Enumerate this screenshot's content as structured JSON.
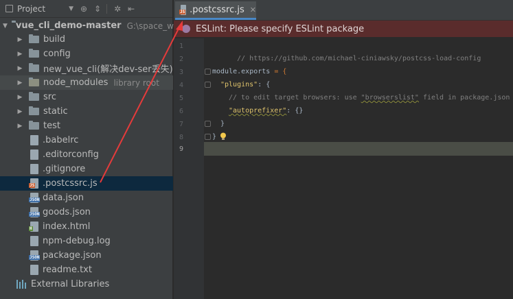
{
  "project_panel": {
    "title": "Project",
    "root": {
      "name": "vue_cli_demo-master",
      "path": "G:\\space_wel"
    },
    "items": [
      {
        "label": "build",
        "type": "folder"
      },
      {
        "label": "config",
        "type": "folder"
      },
      {
        "label": "new_vue_cli(解决dev-ser丢失)",
        "type": "folder"
      },
      {
        "label": "node_modules",
        "type": "folder",
        "hint": "library root"
      },
      {
        "label": "src",
        "type": "folder"
      },
      {
        "label": "static",
        "type": "folder"
      },
      {
        "label": "test",
        "type": "folder"
      },
      {
        "label": ".babelrc",
        "type": "file"
      },
      {
        "label": ".editorconfig",
        "type": "file"
      },
      {
        "label": ".gitignore",
        "type": "file"
      },
      {
        "label": ".postcssrc.js",
        "type": "js",
        "selected": true
      },
      {
        "label": "data.json",
        "type": "json"
      },
      {
        "label": "goods.json",
        "type": "json"
      },
      {
        "label": "index.html",
        "type": "html"
      },
      {
        "label": "npm-debug.log",
        "type": "file"
      },
      {
        "label": "package.json",
        "type": "json"
      },
      {
        "label": "readme.txt",
        "type": "file"
      }
    ],
    "external_libraries": "External Libraries"
  },
  "editor": {
    "tab": {
      "label": ".postcssrc.js"
    },
    "eslint_message": "ESLint: Please specify ESLint package",
    "line_numbers": [
      "1",
      "2",
      "3",
      "4",
      "5",
      "6",
      "7",
      "8",
      "9"
    ],
    "code": {
      "l1": "// https://github.com/michael-ciniawsky/postcss-load-config",
      "l3_kw": "module",
      "l3_dot": ".",
      "l3_exports": "exports",
      "l3_eq": " = {",
      "l4_key": "\"plugins\"",
      "l4_rest": ": {",
      "l5_pre": "// to edit target browsers: use ",
      "l5_str": "\"browserslist\"",
      "l5_post": " field in package.json",
      "l6_key": "\"autoprefixer\"",
      "l6_rest": ": {}",
      "l7": "}",
      "l8": "}"
    }
  },
  "colors": {
    "annotation_arrow": "#e53b3b",
    "eslint_bar": "#5a2c2c",
    "selection": "#0d293e"
  }
}
